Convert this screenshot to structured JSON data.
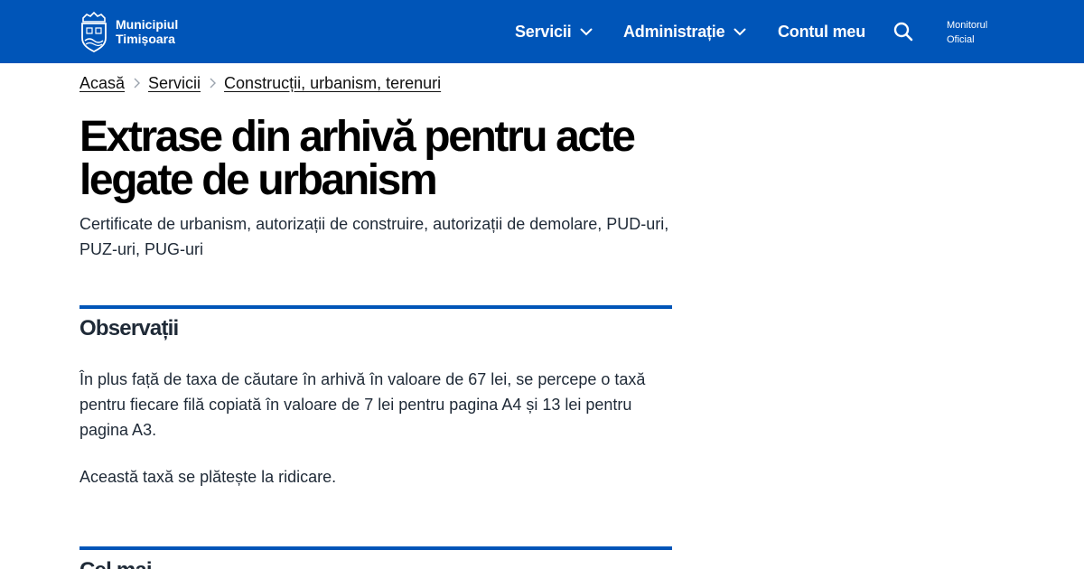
{
  "header": {
    "logo_line1": "Municipiul",
    "logo_line2": "Timișoara",
    "nav": {
      "servicii": "Servicii",
      "administratie": "Administrație",
      "cont": "Contul meu"
    },
    "monitor_line1": "Monitorul",
    "monitor_line2": "Oficial",
    "brand_color": "#0055b8"
  },
  "breadcrumb": [
    "Acasă",
    "Servicii",
    "Construcții, urbanism, terenuri"
  ],
  "page": {
    "title": "Extrase din arhivă pentru acte legate de urbanism",
    "subtitle": "Certificate de urbanism, autorizații de construire, autorizații de demolare, PUD-uri, PUZ-uri, PUG-uri"
  },
  "sections": {
    "observatii": {
      "heading": "Observații",
      "paragraphs": [
        "În plus față de taxa de căutare în arhivă în valoare de 67 lei, se percepe o taxă pentru fiecare filă copiată în valoare de 7 lei pentru pagina A4 și 13 lei pentru pagina A3.",
        "Această taxă se plătește la ridicare."
      ]
    },
    "next": {
      "heading": "Cel mai"
    }
  }
}
